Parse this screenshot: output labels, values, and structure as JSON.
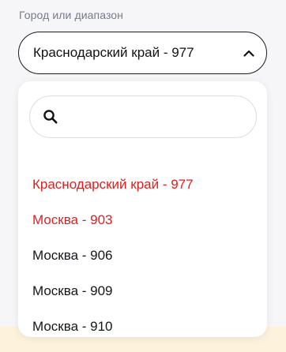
{
  "field": {
    "label": "Город или диапазон",
    "selected_value": "Краснодарский край - 977"
  },
  "search": {
    "placeholder": "",
    "value": ""
  },
  "options": [
    {
      "label": "Краснодарский край - 977",
      "highlighted": true
    },
    {
      "label": "Москва - 903",
      "highlighted": true
    },
    {
      "label": "Москва - 906",
      "highlighted": false
    },
    {
      "label": "Москва - 909",
      "highlighted": false
    },
    {
      "label": "Москва - 910",
      "highlighted": false
    }
  ],
  "colors": {
    "highlight": "#e01e1e",
    "text": "#15161a",
    "border": "#1b1b1f",
    "page_bg": "#f6f6f8",
    "bottom_strip": "#fdf3dd"
  },
  "icons": {
    "toggle": "chevron-up-icon",
    "search": "search-icon"
  }
}
